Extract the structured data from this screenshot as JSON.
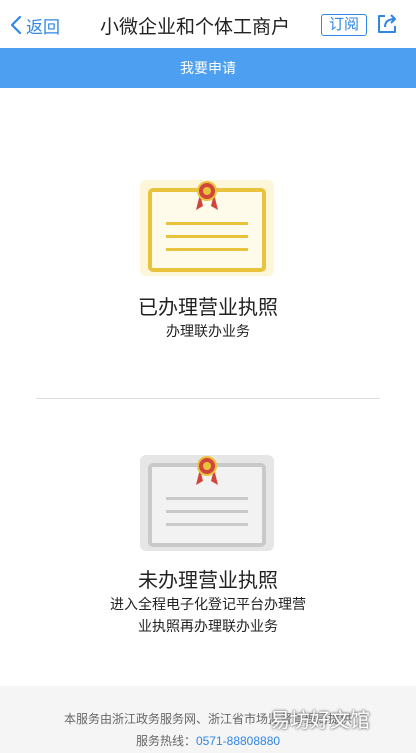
{
  "nav": {
    "back_label": "返回",
    "title": "小微企业和个体工商户",
    "subscribe_label": "订阅"
  },
  "apply_bar": {
    "label": "我要申请"
  },
  "options": [
    {
      "title": "已办理营业执照",
      "desc": "办理联办业务",
      "icon_color": "#e9c33b"
    },
    {
      "title": "未办理营业执照",
      "desc_line1": "进入全程电子化登记平台办理营",
      "desc_line2": "业执照再办理联办业务",
      "icon_color": "#c9c9c9"
    }
  ],
  "footer": {
    "line1": "本服务由浙江政务服务网、浙江省市场监督管理局提供",
    "hotline_label": "服务热线：",
    "hotline_number": "0571-88808880"
  },
  "watermark": "易坊好文馆",
  "colors": {
    "accent": "#2f86e6",
    "bar": "#4d9ff1"
  }
}
